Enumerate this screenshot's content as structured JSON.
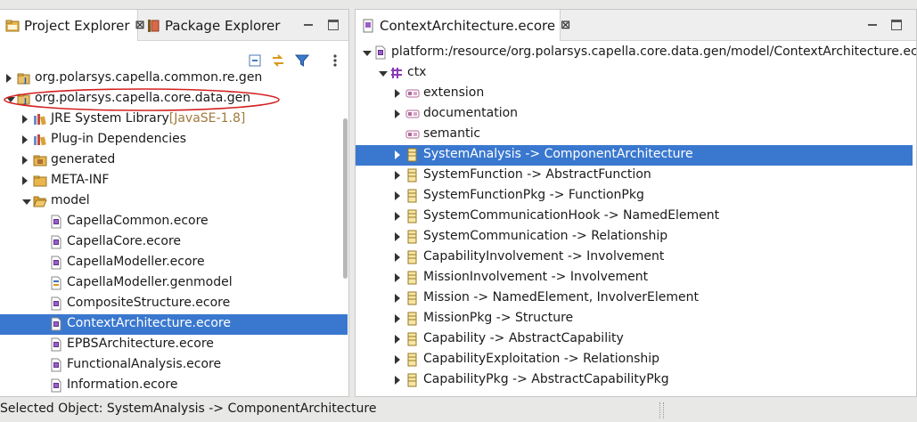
{
  "left_panel": {
    "tabs": [
      {
        "label": "Project Explorer",
        "close": "⊠",
        "active": true
      },
      {
        "label": "Package Explorer",
        "active": false
      }
    ],
    "tree": [
      {
        "label": "org.polarsys.capella.common.re.gen",
        "icon": "java-project-icon",
        "state": "collapsed",
        "level": 0
      },
      {
        "label": "org.polarsys.capella.core.data.gen",
        "icon": "java-project-icon",
        "state": "expanded",
        "level": 0,
        "highlighted": true
      },
      {
        "label": "JRE System Library",
        "decoration": "[JavaSE-1.8]",
        "icon": "library-icon",
        "state": "collapsed",
        "level": 1
      },
      {
        "label": "Plug-in Dependencies",
        "icon": "library-icon",
        "state": "collapsed",
        "level": 1
      },
      {
        "label": "generated",
        "icon": "source-folder-icon",
        "state": "collapsed",
        "level": 1
      },
      {
        "label": "META-INF",
        "icon": "folder-icon",
        "state": "collapsed",
        "level": 1
      },
      {
        "label": "model",
        "icon": "open-folder-icon",
        "state": "expanded",
        "level": 1
      },
      {
        "label": "CapellaCommon.ecore",
        "icon": "ecore-file-icon",
        "level": 2
      },
      {
        "label": "CapellaCore.ecore",
        "icon": "ecore-file-icon",
        "level": 2
      },
      {
        "label": "CapellaModeller.ecore",
        "icon": "ecore-file-icon",
        "level": 2
      },
      {
        "label": "CapellaModeller.genmodel",
        "icon": "genmodel-file-icon",
        "level": 2
      },
      {
        "label": "CompositeStructure.ecore",
        "icon": "ecore-file-icon",
        "level": 2
      },
      {
        "label": "ContextArchitecture.ecore",
        "icon": "ecore-file-icon",
        "level": 2,
        "selected": true
      },
      {
        "label": "EPBSArchitecture.ecore",
        "icon": "ecore-file-icon",
        "level": 2
      },
      {
        "label": "FunctionalAnalysis.ecore",
        "icon": "ecore-file-icon",
        "level": 2
      },
      {
        "label": "Information.ecore",
        "icon": "ecore-file-icon",
        "level": 2
      }
    ]
  },
  "right_panel": {
    "tab": {
      "label": "ContextArchitecture.ecore",
      "close": "⊠"
    },
    "tree": [
      {
        "label": "platform:/resource/org.polarsys.capella.core.data.gen/model/ContextArchitecture.ecore",
        "icon": "ecore-resource-icon",
        "state": "expanded",
        "level": 0
      },
      {
        "label": "ctx",
        "icon": "epackage-icon",
        "state": "expanded",
        "level": 1
      },
      {
        "label": "extension",
        "icon": "eannotation-icon",
        "state": "collapsed",
        "level": 2
      },
      {
        "label": "documentation",
        "icon": "eannotation-icon",
        "state": "collapsed",
        "level": 2
      },
      {
        "label": "semantic",
        "icon": "eannotation-icon",
        "level": 2
      },
      {
        "label": "SystemAnalysis -> ComponentArchitecture",
        "icon": "eclass-icon",
        "state": "collapsed",
        "level": 2,
        "selected": true
      },
      {
        "label": "SystemFunction -> AbstractFunction",
        "icon": "eclass-icon",
        "state": "collapsed",
        "level": 2
      },
      {
        "label": "SystemFunctionPkg -> FunctionPkg",
        "icon": "eclass-icon",
        "state": "collapsed",
        "level": 2
      },
      {
        "label": "SystemCommunicationHook -> NamedElement",
        "icon": "eclass-icon",
        "state": "collapsed",
        "level": 2
      },
      {
        "label": "SystemCommunication -> Relationship",
        "icon": "eclass-icon",
        "state": "collapsed",
        "level": 2
      },
      {
        "label": "CapabilityInvolvement -> Involvement",
        "icon": "eclass-icon",
        "state": "collapsed",
        "level": 2
      },
      {
        "label": "MissionInvolvement -> Involvement",
        "icon": "eclass-icon",
        "state": "collapsed",
        "level": 2
      },
      {
        "label": "Mission -> NamedElement, InvolverElement",
        "icon": "eclass-icon",
        "state": "collapsed",
        "level": 2
      },
      {
        "label": "MissionPkg -> Structure",
        "icon": "eclass-icon",
        "state": "collapsed",
        "level": 2
      },
      {
        "label": "Capability -> AbstractCapability",
        "icon": "eclass-icon",
        "state": "collapsed",
        "level": 2
      },
      {
        "label": "CapabilityExploitation -> Relationship",
        "icon": "eclass-icon",
        "state": "collapsed",
        "level": 2
      },
      {
        "label": "CapabilityPkg -> AbstractCapabilityPkg",
        "icon": "eclass-icon",
        "state": "collapsed",
        "level": 2
      }
    ]
  },
  "status_bar": {
    "text": "Selected Object: SystemAnalysis -> ComponentArchitecture"
  },
  "colors": {
    "selection": "#3a78cf",
    "highlight_ellipse": "#d42020"
  }
}
